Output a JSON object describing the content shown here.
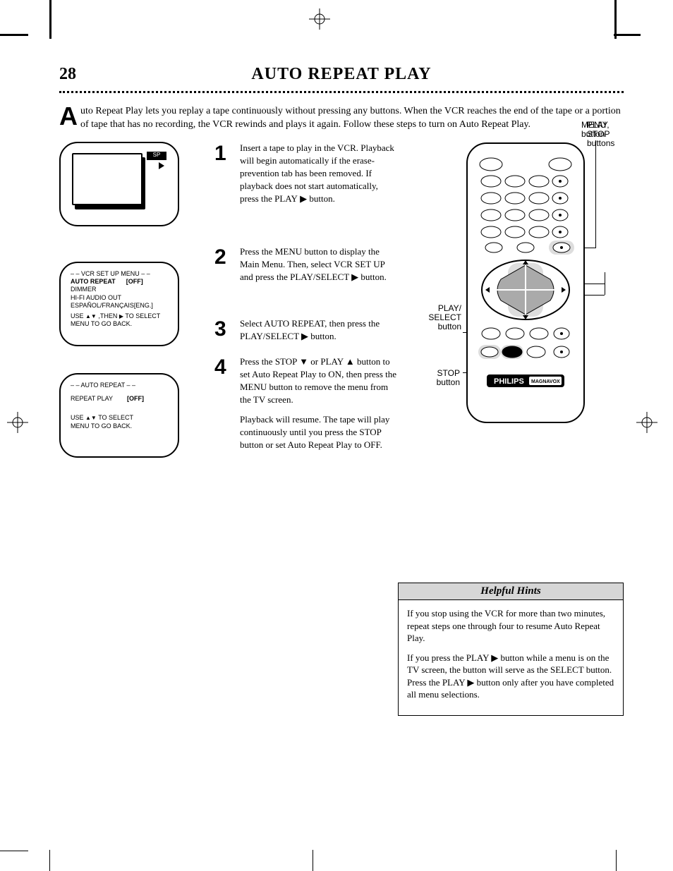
{
  "page_number": "28",
  "page_title": "AUTO REPEAT PLAY",
  "intro_dropcap": "A",
  "intro_text": "uto Repeat Play lets you replay a tape continuously without pressing any buttons. When the VCR reaches the end of the tape or a portion of tape that has no recording, the VCR rewinds and plays it again. Follow these steps to turn on Auto Repeat Play.",
  "tv_pic_label": "SP",
  "tv2": {
    "l1": "– – VCR SET UP MENU – –",
    "l2_a": "AUTO REPEAT",
    "l2_b": "[OFF]",
    "l3": "DIMMER",
    "l4": "HI-FI AUDIO OUT",
    "l5": "ESPAÑOL/FRANÇAIS[ENG.]",
    "l6": "USE     ,THEN       TO SELECT",
    "l7": "MENU TO GO BACK."
  },
  "tv3": {
    "l1": "– – AUTO REPEAT – –",
    "l2a": "REPEAT PLAY",
    "l2b": "[OFF]",
    "l3": "USE      TO SELECT",
    "l4": "MENU TO GO BACK."
  },
  "step1": "Insert a tape to play in the VCR. Playback will begin automatically if the erase-prevention tab has been removed. If playback does not start automatically, press the PLAY ▶ button.",
  "step2": "Press the MENU button to display the Main Menu. Then, select VCR SET UP and press the PLAY/SELECT ▶ button.",
  "step3": "Select AUTO REPEAT, then press the PLAY/SELECT ▶ button.",
  "step4_p1": "Press the STOP ▼ or PLAY ▲ button to set Auto Repeat Play to ON, then press the MENU button to remove the menu from the TV screen.",
  "step4_p2": "Playback will resume. The tape will play continuously until you press the STOP button or set Auto Repeat Play to OFF.",
  "remote_labels": {
    "menu": "MENU\nbutton",
    "play_stop": "PLAY,\nSTOP\nbuttons",
    "play_select": "PLAY/SELECT\nbutton",
    "stop": "STOP\nbutton"
  },
  "remote_brand_a": "PHILIPS",
  "remote_brand_b": "MAGNAVOX",
  "hints_title": "Helpful Hints",
  "hints_p1": "If you stop using the VCR for more than two minutes, repeat steps one through four to resume Auto Repeat Play.",
  "hints_p2": "If you press the PLAY ▶ button while a menu is on the TV screen, the button will serve as the SELECT button. Press the PLAY ▶ button only after you have completed all menu selections."
}
